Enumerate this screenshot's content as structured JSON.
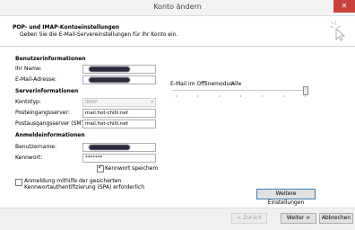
{
  "window": {
    "title": "Konto ändern",
    "close_symbol": "✕"
  },
  "header": {
    "title": "POP- und IMAP-Kontoeinstellungen",
    "subtitle": "Geben Sie die E-Mail-Servereinstellungen für Ihr Konto ein."
  },
  "user_info": {
    "heading": "Benutzerinformationen",
    "name_label": "Ihr Name:",
    "email_label": "E-Mail-Adresse:"
  },
  "server_info": {
    "heading": "Serverinformationen",
    "account_type_label": "Kontotyp:",
    "account_type_value": "IMAP",
    "incoming_label": "Posteingangsserver:",
    "incoming_value": "mail.hot-chilli.net",
    "outgoing_label": "Postausgangsserver (SMTP):",
    "outgoing_value": "mail.hot-chilli.net"
  },
  "login_info": {
    "heading": "Anmeldeinformationen",
    "username_label": "Benutzername:",
    "password_label": "Kennwort:",
    "password_value": "*******",
    "remember_label": "Kennwort speichern",
    "remember_checked": true
  },
  "spa": {
    "label_line1": "Anmeldung mithilfe der gesicherten",
    "label_line2": "Kennwortauthentifizierung (SPA) erforderlich",
    "checked": false
  },
  "offline": {
    "label": "E-Mail im Offlinemodus:",
    "value": "Alle"
  },
  "buttons": {
    "more_settings": "Weitere Einstellungen",
    "back": "< Zurück",
    "next": "Weiter >",
    "cancel": "Abbrechen"
  }
}
